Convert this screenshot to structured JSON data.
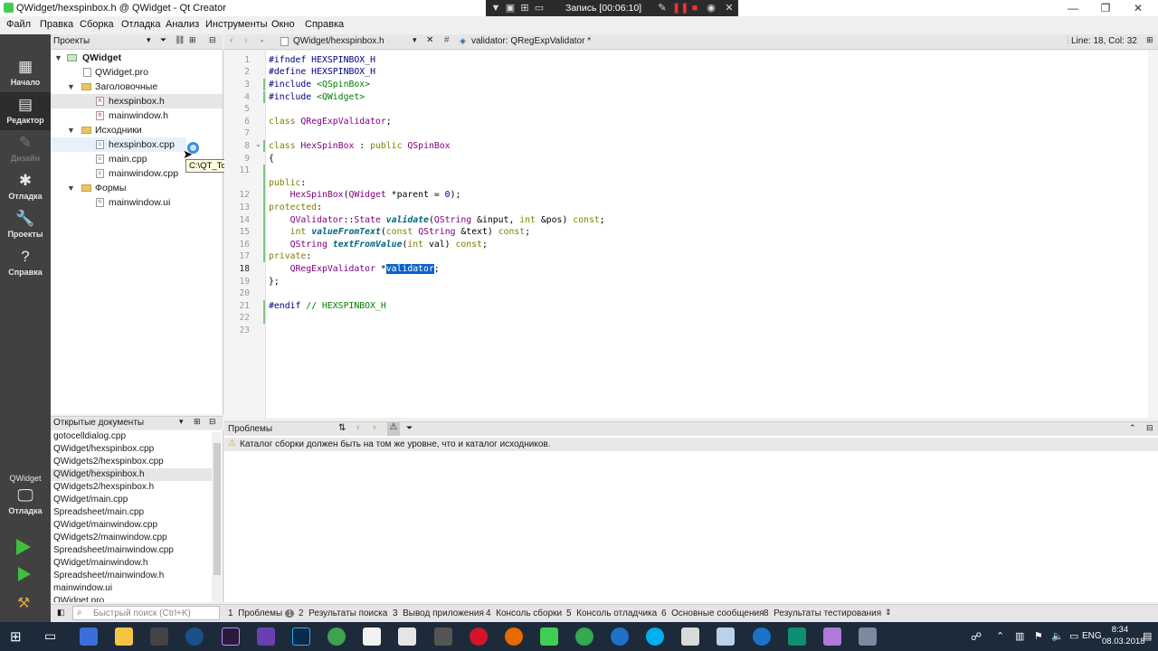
{
  "window": {
    "title": "QWidget/hexspinbox.h @ QWidget - Qt Creator",
    "recording": "Запись [00:06:10]"
  },
  "menubar": [
    "Файл",
    "Правка",
    "Сборка",
    "Отладка",
    "Анализ",
    "Инструменты",
    "Окно",
    "Справка"
  ],
  "modes": [
    {
      "label": "Начало",
      "icon": "grid-icon"
    },
    {
      "label": "Редактор",
      "icon": "editor-icon"
    },
    {
      "label": "Дизайн",
      "icon": "pen-icon"
    },
    {
      "label": "Отладка",
      "icon": "bug-icon"
    },
    {
      "label": "Проекты",
      "icon": "wrench-icon"
    },
    {
      "label": "Справка",
      "icon": "help-icon"
    }
  ],
  "kit": {
    "project": "QWidget",
    "mode": "Отладка"
  },
  "projects": {
    "header": "Проекты",
    "tree": [
      {
        "label": "QWidget",
        "depth": 0,
        "kind": "project",
        "expanded": true
      },
      {
        "label": "QWidget.pro",
        "depth": 1,
        "kind": "pro"
      },
      {
        "label": "Заголовочные",
        "depth": 1,
        "kind": "folder",
        "expanded": true
      },
      {
        "label": "hexspinbox.h",
        "depth": 2,
        "kind": "h",
        "selected": true
      },
      {
        "label": "mainwindow.h",
        "depth": 2,
        "kind": "h"
      },
      {
        "label": "Исходники",
        "depth": 1,
        "kind": "folder",
        "expanded": true
      },
      {
        "label": "hexspinbox.cpp",
        "depth": 2,
        "kind": "cpp",
        "hovered": true
      },
      {
        "label": "main.cpp",
        "depth": 2,
        "kind": "cpp"
      },
      {
        "label": "mainwindow.cpp",
        "depth": 2,
        "kind": "cpp"
      },
      {
        "label": "Формы",
        "depth": 1,
        "kind": "folder",
        "expanded": true
      },
      {
        "label": "mainwindow.ui",
        "depth": 2,
        "kind": "ui"
      }
    ],
    "tooltip": "C:\\QT_Tools\\QWidgets\\QWidget\\hexspinbox.cpp"
  },
  "open_documents": {
    "header": "Открытые документы",
    "items": [
      "gotocelldialog.cpp",
      "QWidget/hexspinbox.cpp",
      "QWidgets2/hexspinbox.cpp",
      "QWidget/hexspinbox.h",
      "QWidgets2/hexspinbox.h",
      "QWidget/main.cpp",
      "Spreadsheet/main.cpp",
      "QWidget/mainwindow.cpp",
      "QWidgets2/mainwindow.cpp",
      "Spreadsheet/mainwindow.cpp",
      "QWidget/mainwindow.h",
      "Spreadsheet/mainwindow.h",
      "mainwindow.ui",
      "QWidget.pro"
    ],
    "selected_index": 3
  },
  "editor": {
    "file_tab": "QWidget/hexspinbox.h",
    "symbol": "validator: QRegExpValidator *",
    "position": "Line: 18, Col: 32",
    "line_numbers": [
      "1",
      "2",
      "3",
      "4",
      "5",
      "6",
      "7",
      "8",
      "9",
      "11",
      "12",
      "13",
      "14",
      "15",
      "16",
      "17",
      "18",
      "19",
      "20",
      "21",
      "22",
      "23"
    ],
    "current_line": "18"
  },
  "problems": {
    "header": "Проблемы",
    "warning": "Каталог сборки должен быть на том же уровне, что и каталог исходников."
  },
  "output_tabs": [
    {
      "num": "1",
      "label": "Проблемы",
      "badge": "1"
    },
    {
      "num": "2",
      "label": "Результаты поиска"
    },
    {
      "num": "3",
      "label": "Вывод приложения"
    },
    {
      "num": "4",
      "label": "Консоль сборки"
    },
    {
      "num": "5",
      "label": "Консоль отладчика"
    },
    {
      "num": "6",
      "label": "Основные сообщения"
    },
    {
      "num": "8",
      "label": "Результаты тестирования"
    }
  ],
  "search_placeholder": "Быстрый поиск (Ctrl+K)",
  "taskbar": {
    "lang": "ENG",
    "time": "8:34",
    "date": "08.03.2018"
  }
}
